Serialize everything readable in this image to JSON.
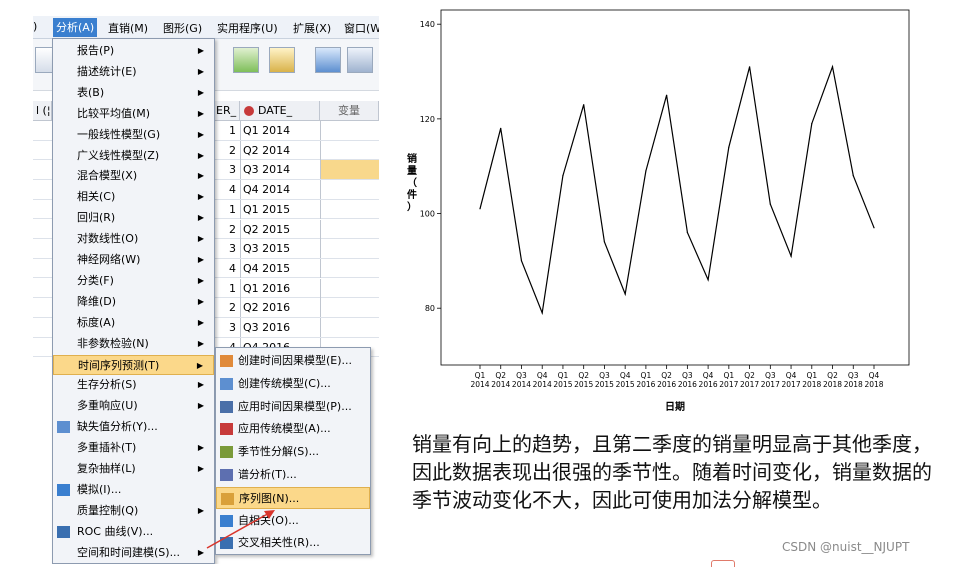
{
  "menubar": {
    "items": [
      {
        "label": ")"
      },
      {
        "label": "分析(A)"
      },
      {
        "label": "直销(M)"
      },
      {
        "label": "图形(G)"
      },
      {
        "label": "实用程序(U)"
      },
      {
        "label": "扩展(X)"
      },
      {
        "label": "窗口(W"
      }
    ]
  },
  "grid": {
    "headers": {
      "left": "l (¦",
      "er": "ER_",
      "date": "DATE_",
      "var": "变量"
    },
    "rows": [
      {
        "n": "1",
        "v": "Q1 2014"
      },
      {
        "n": "2",
        "v": "Q2 2014"
      },
      {
        "n": "3",
        "v": "Q3 2014"
      },
      {
        "n": "4",
        "v": "Q4 2014"
      },
      {
        "n": "1",
        "v": "Q1 2015"
      },
      {
        "n": "2",
        "v": "Q2 2015"
      },
      {
        "n": "3",
        "v": "Q3 2015"
      },
      {
        "n": "4",
        "v": "Q4 2015"
      },
      {
        "n": "1",
        "v": "Q1 2016"
      },
      {
        "n": "2",
        "v": "Q2 2016"
      },
      {
        "n": "3",
        "v": "Q3 2016"
      },
      {
        "n": "4",
        "v": "Q4 2016"
      }
    ]
  },
  "analyze_menu": {
    "items": [
      {
        "label": "报告(P)",
        "arrow": "▶"
      },
      {
        "label": "描述统计(E)",
        "arrow": "▶"
      },
      {
        "label": "表(B)",
        "arrow": "▶"
      },
      {
        "label": "比较平均值(M)",
        "arrow": "▶"
      },
      {
        "label": "一般线性模型(G)",
        "arrow": "▶"
      },
      {
        "label": "广义线性模型(Z)",
        "arrow": "▶"
      },
      {
        "label": "混合模型(X)",
        "arrow": "▶"
      },
      {
        "label": "相关(C)",
        "arrow": "▶"
      },
      {
        "label": "回归(R)",
        "arrow": "▶"
      },
      {
        "label": "对数线性(O)",
        "arrow": "▶"
      },
      {
        "label": "神经网络(W)",
        "arrow": "▶"
      },
      {
        "label": "分类(F)",
        "arrow": "▶"
      },
      {
        "label": "降维(D)",
        "arrow": "▶"
      },
      {
        "label": "标度(A)",
        "arrow": "▶"
      },
      {
        "label": "非参数检验(N)",
        "arrow": "▶"
      },
      {
        "label": "时间序列预测(T)",
        "arrow": "▶"
      },
      {
        "label": "生存分析(S)",
        "arrow": "▶"
      },
      {
        "label": "多重响应(U)",
        "arrow": "▶"
      },
      {
        "label": "缺失值分析(Y)...",
        "arrow": ""
      },
      {
        "label": "多重插补(T)",
        "arrow": "▶"
      },
      {
        "label": "复杂抽样(L)",
        "arrow": "▶"
      },
      {
        "label": "模拟(I)...",
        "arrow": ""
      },
      {
        "label": "质量控制(Q)",
        "arrow": "▶"
      },
      {
        "label": "ROC 曲线(V)...",
        "arrow": ""
      },
      {
        "label": "空间和时间建模(S)...",
        "arrow": "▶"
      }
    ],
    "selected_index": 15
  },
  "timeseries_submenu": {
    "items": [
      {
        "label": "创建时间因果模型(E)..."
      },
      {
        "label": "创建传统模型(C)..."
      },
      {
        "label": "应用时间因果模型(P)..."
      },
      {
        "label": "应用传统模型(A)..."
      },
      {
        "label": "季节性分解(S)..."
      },
      {
        "label": "谱分析(T)..."
      },
      {
        "label": "序列图(N)..."
      },
      {
        "label": "自相关(O)..."
      },
      {
        "label": "交叉相关性(R)..."
      }
    ],
    "selected_index": 6
  },
  "chart_data": {
    "type": "line",
    "x": [
      "Q1 2014",
      "Q2 2014",
      "Q3 2014",
      "Q4 2014",
      "Q1 2015",
      "Q2 2015",
      "Q3 2015",
      "Q4 2015",
      "Q1 2016",
      "Q2 2016",
      "Q3 2016",
      "Q4 2016",
      "Q1 2017",
      "Q2 2017",
      "Q3 2017",
      "Q4 2017",
      "Q1 2018",
      "Q2 2018",
      "Q3 2018",
      "Q4 2018"
    ],
    "x_tick_top": [
      "Q1",
      "Q2",
      "Q3",
      "Q4",
      "Q1",
      "Q2",
      "Q3",
      "Q4",
      "Q1",
      "Q2",
      "Q3",
      "Q4",
      "Q1",
      "Q2",
      "Q3",
      "Q4",
      "Q1",
      "Q2",
      "Q3",
      "Q4"
    ],
    "x_tick_bottom": [
      "2014",
      "2014",
      "2014",
      "2014",
      "2015",
      "2015",
      "2015",
      "2015",
      "2016",
      "2016",
      "2016",
      "2016",
      "2017",
      "2017",
      "2017",
      "2017",
      "2018",
      "2018",
      "2018",
      "2018"
    ],
    "values": [
      101,
      118,
      90,
      79,
      108,
      123,
      94,
      83,
      109,
      125,
      96,
      86,
      114,
      131,
      102,
      91,
      119,
      131,
      108,
      97
    ],
    "yticks": [
      80,
      100,
      120,
      140
    ],
    "ylim": [
      68,
      143
    ],
    "xlabel": "日期",
    "ylabel": "销量（件）",
    "grid": false,
    "line_color": "#000000"
  },
  "paragraph": {
    "text": "销量有向上的趋势，且第二季度的销量明显高于其他季度，因此数据表现出很强的季节性。随着时间变化，销量数据的季节波动变化不大，因此可使用加法分解模型。"
  },
  "watermark": {
    "text": "CSDN @nuist__NJUPT"
  },
  "colors": {
    "menu_highlight": "#fbd88a",
    "menubar_active": "#3a7fcf",
    "arrow": "#d9342b"
  }
}
